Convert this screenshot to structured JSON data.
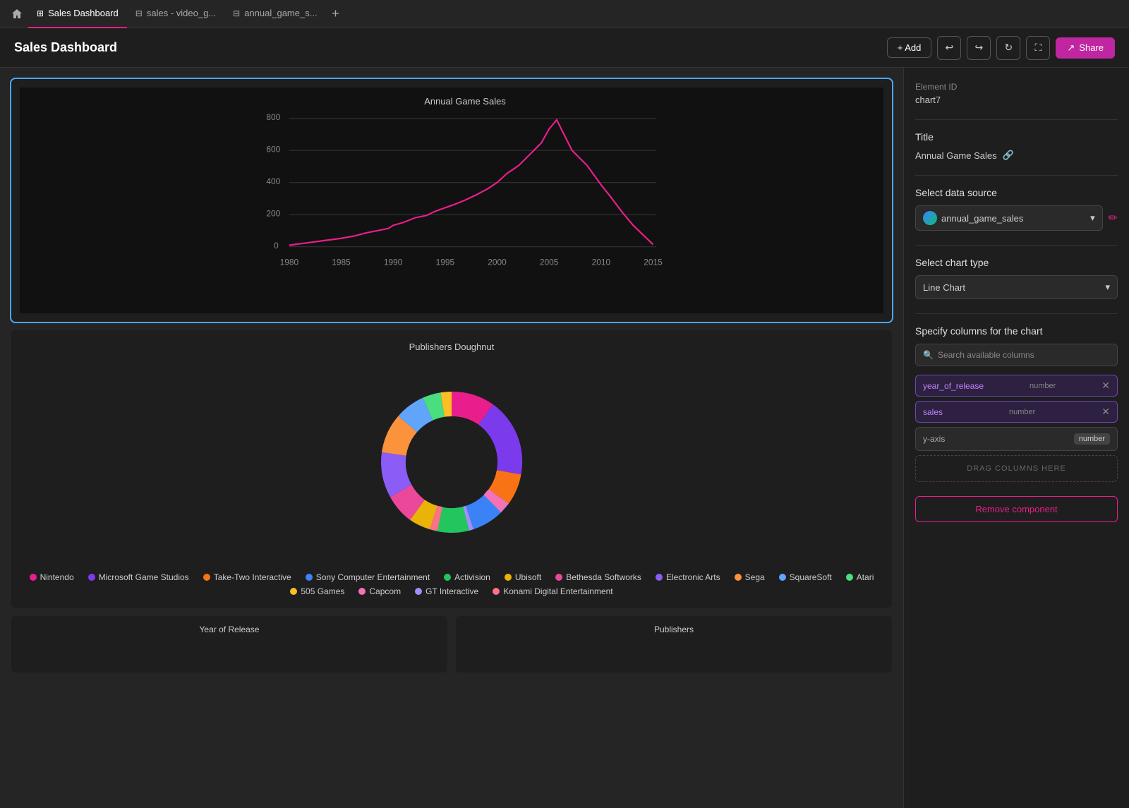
{
  "tabs": [
    {
      "id": "home",
      "type": "home",
      "label": ""
    },
    {
      "id": "sales-dashboard",
      "label": "Sales Dashboard",
      "icon": "dashboard",
      "active": true
    },
    {
      "id": "sales-video-g",
      "label": "sales - video_g...",
      "icon": "table"
    },
    {
      "id": "annual-game-s",
      "label": "annual_game_s...",
      "icon": "table"
    }
  ],
  "header": {
    "title": "Sales Dashboard",
    "add_label": "+ Add",
    "share_label": "Share"
  },
  "right_panel": {
    "element_id_label": "Element ID",
    "element_id_value": "chart7",
    "title_label": "Title",
    "title_value": "Annual Game Sales",
    "datasource_label": "Select data source",
    "datasource_value": "annual_game_sales",
    "chart_type_label": "Select chart type",
    "chart_type_value": "Line Chart",
    "columns_label": "Specify columns for the chart",
    "search_placeholder": "Search available columns",
    "column_tags": [
      {
        "name": "year_of_release",
        "type": "number"
      },
      {
        "name": "sales",
        "type": "number"
      }
    ],
    "yaxis": {
      "label": "y-axis",
      "type": "number"
    },
    "drag_label": "DRAG COLUMNS HERE",
    "remove_label": "Remove component"
  },
  "line_chart": {
    "title": "Annual Game Sales",
    "x_labels": [
      "1980",
      "1985",
      "1990",
      "1995",
      "2000",
      "2005",
      "2010",
      "2015"
    ],
    "y_labels": [
      "800",
      "600",
      "400",
      "200",
      "0"
    ]
  },
  "donut_chart": {
    "title": "Publishers Doughnut",
    "legend": [
      {
        "label": "Nintendo",
        "color": "#e91e8c"
      },
      {
        "label": "Microsoft Game Studios",
        "color": "#7c3aed"
      },
      {
        "label": "Take-Two Interactive",
        "color": "#f97316"
      },
      {
        "label": "Sony Computer Entertainment",
        "color": "#3b82f6"
      },
      {
        "label": "Activision",
        "color": "#22c55e"
      },
      {
        "label": "Ubisoft",
        "color": "#eab308"
      },
      {
        "label": "Bethesda Softworks",
        "color": "#ec4899"
      },
      {
        "label": "Electronic Arts",
        "color": "#8b5cf6"
      },
      {
        "label": "Sega",
        "color": "#fb923c"
      },
      {
        "label": "SquareSoft",
        "color": "#60a5fa"
      },
      {
        "label": "Atari",
        "color": "#4ade80"
      },
      {
        "label": "505 Games",
        "color": "#fbbf24"
      },
      {
        "label": "Capcom",
        "color": "#f472b6"
      },
      {
        "label": "GT Interactive",
        "color": "#a78bfa"
      },
      {
        "label": "Konami Digital Entertainment",
        "color": "#fb7185"
      }
    ]
  },
  "bottom_cards": [
    {
      "title": "Year of Release"
    },
    {
      "title": "Publishers"
    }
  ]
}
